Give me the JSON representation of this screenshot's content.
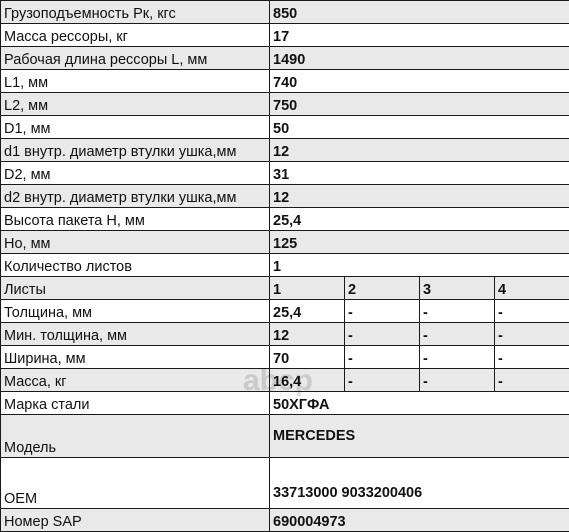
{
  "specs_top": [
    {
      "label": "Грузоподъемность Pк, кгс",
      "value": "850"
    },
    {
      "label": "Масса рессоры, кг",
      "value": "17"
    },
    {
      "label": "Рабочая длина рессоры L, мм",
      "value": "1490"
    },
    {
      "label": "L1, мм",
      "value": "740"
    },
    {
      "label": "L2, мм",
      "value": "750"
    },
    {
      "label": "D1, мм",
      "value": "50"
    },
    {
      "label": "d1 внутр. диаметр втулки ушка,мм",
      "value": "12"
    },
    {
      "label": "D2, мм",
      "value": "31"
    },
    {
      "label": "d2 внутр. диаметр втулки ушка,мм",
      "value": "12"
    },
    {
      "label": "Высота пакета H, мм",
      "value": "25,4"
    },
    {
      "label": "Ho, мм",
      "value": "125"
    },
    {
      "label": "Количество листов",
      "value": "1"
    }
  ],
  "leaves": {
    "label": "Листы",
    "columns": [
      "1",
      "2",
      "3",
      "4"
    ],
    "rows": [
      {
        "label": "Толщина, мм",
        "values": [
          "25,4",
          "-",
          "-",
          "-"
        ]
      },
      {
        "label": "Мин. толщина, мм",
        "values": [
          "12",
          "-",
          "-",
          "-"
        ]
      },
      {
        "label": "Ширина, мм",
        "values": [
          "70",
          "-",
          "-",
          "-"
        ]
      },
      {
        "label": "Масса, кг",
        "values": [
          "16,4",
          "-",
          "-",
          "-"
        ]
      }
    ]
  },
  "specs_bottom": {
    "steel": {
      "label": "Марка стали",
      "value": "50ХГФА"
    },
    "model": {
      "label": "Модель",
      "value": "MERCEDES"
    },
    "oem": {
      "label": "OEM",
      "value": "33713000 9033200406"
    },
    "sap": {
      "label": "Номер SAP",
      "value": "690004973"
    }
  },
  "watermark": {
    "text": "abcp"
  }
}
